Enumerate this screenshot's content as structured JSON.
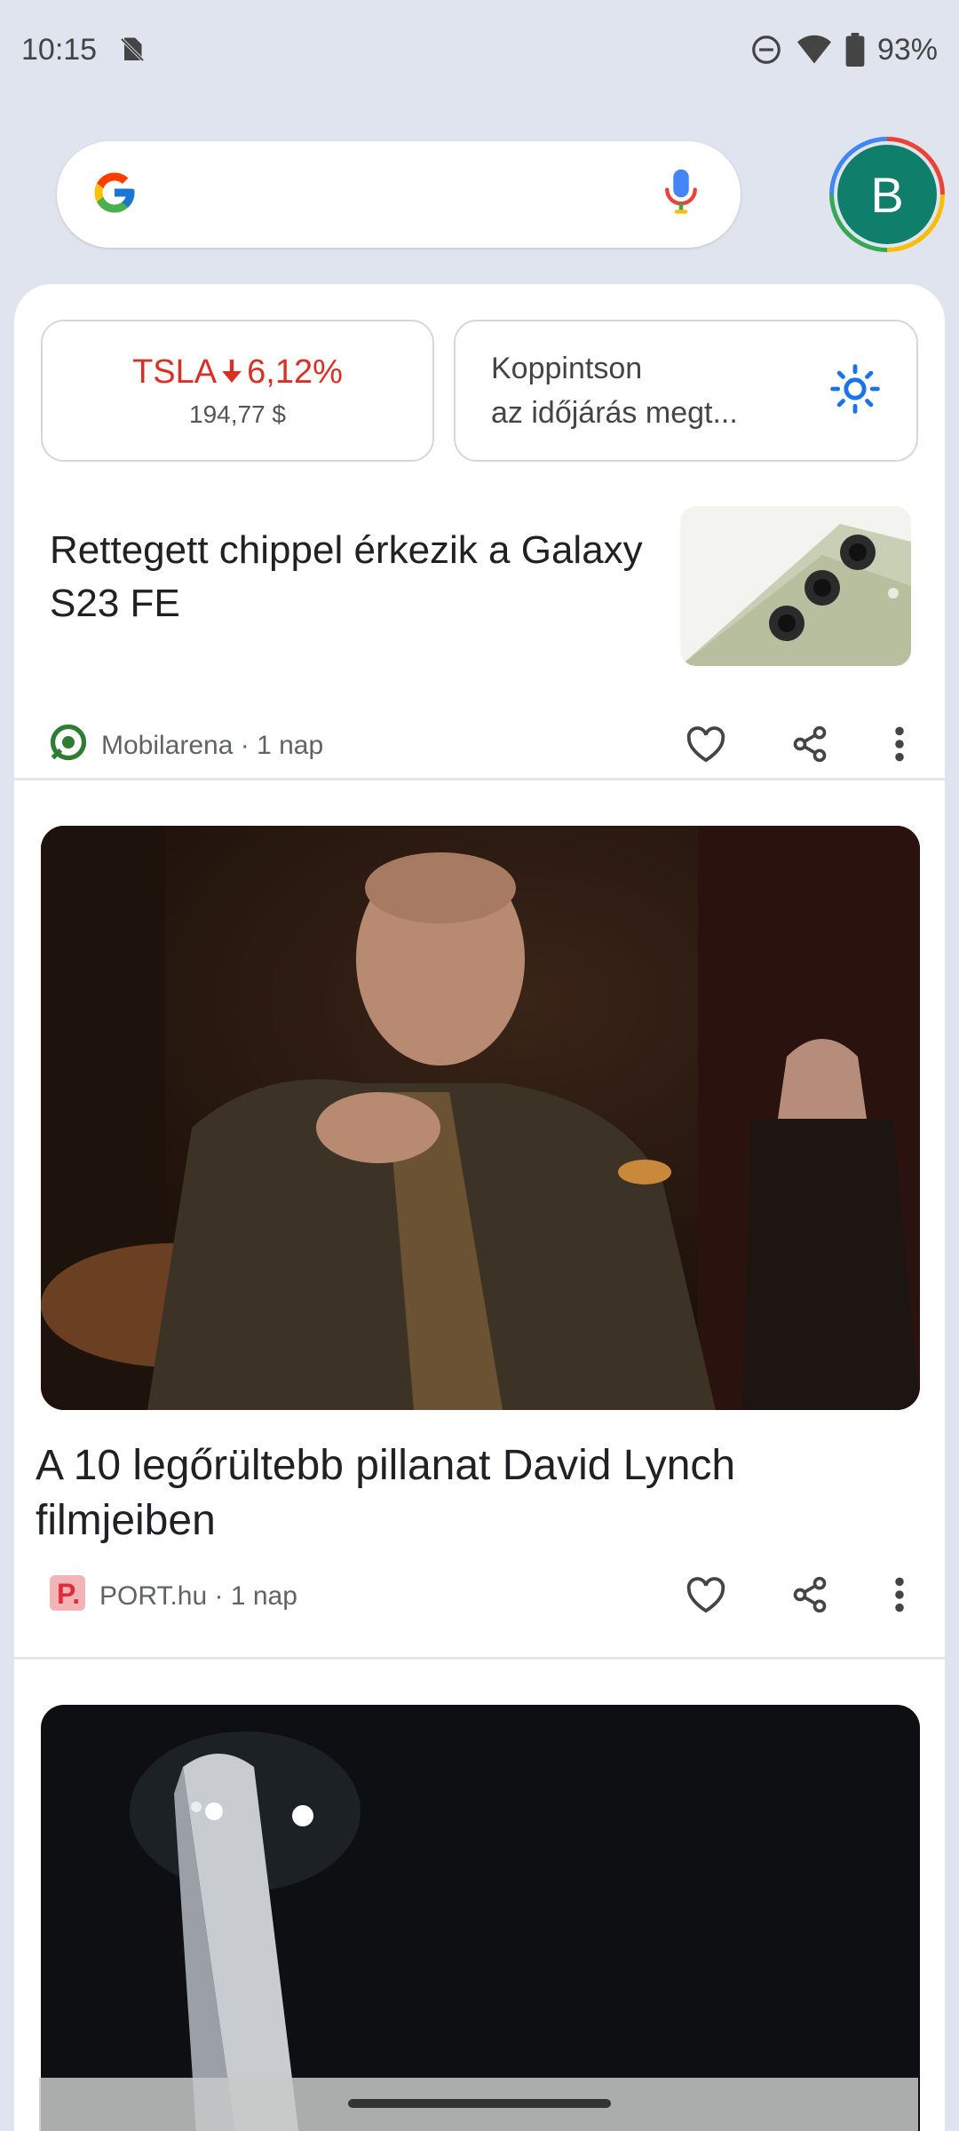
{
  "status_bar": {
    "time": "10:15",
    "battery": "93%",
    "icons": [
      "no-sim-icon",
      "do-not-disturb-icon",
      "wifi-icon",
      "battery-icon"
    ]
  },
  "search": {
    "avatar_letter": "B",
    "icons": [
      "google-logo-icon",
      "mic-icon"
    ]
  },
  "chips": {
    "stock_symbol": "TSLA",
    "stock_change": "6,12%",
    "stock_price": "194,77 $",
    "weather_line1": "Koppintson",
    "weather_line2": "az időjárás megt..."
  },
  "articles": [
    {
      "title": "Rettegett chippel érkezik a Galaxy S23 FE",
      "source": "Mobilarena · 1 nap"
    },
    {
      "title": "A 10 legőrültebb pillanat David Lynch filmjeiben",
      "source": "PORT.hu · 1 nap"
    }
  ],
  "colors": {
    "background": "#dfe4ee",
    "stock_down": "#d93025",
    "avatar": "#0f7f6b",
    "weather_icon": "#1a73e8"
  }
}
